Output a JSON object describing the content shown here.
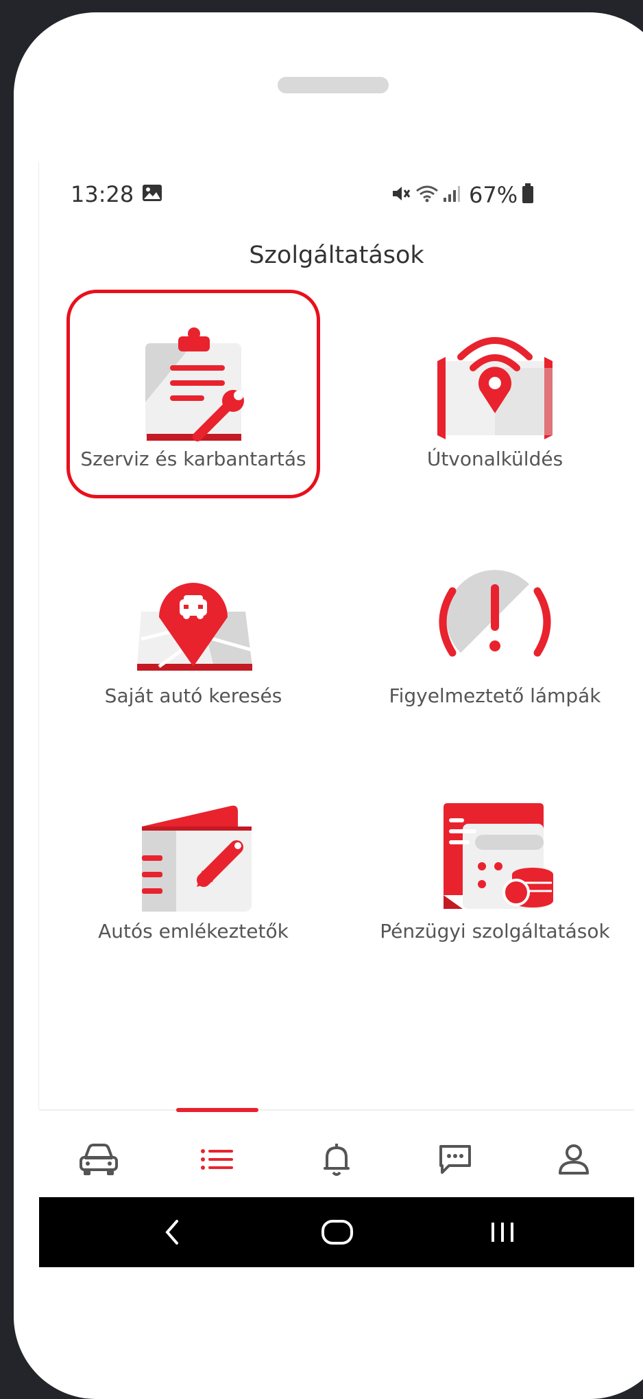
{
  "status_bar": {
    "time": "13:28",
    "image_icon": "image-icon",
    "mute_icon": "mute-icon",
    "wifi_icon": "wifi-icon",
    "signal_icon": "signal-icon",
    "battery_percent": "67%",
    "battery_icon": "battery-icon"
  },
  "header": {
    "title": "Szolgáltatások"
  },
  "services": [
    {
      "label": "Szerviz és karbantartás",
      "icon": "clipboard-wrench-icon",
      "selected": true
    },
    {
      "label": "Útvonalküldés",
      "icon": "map-pin-signal-icon"
    },
    {
      "label": "Saját autó keresés",
      "icon": "car-location-pin-icon"
    },
    {
      "label": "Figyelmeztető lámpák",
      "icon": "warning-light-icon"
    },
    {
      "label": "Autós emlékeztetők",
      "icon": "notebook-pencil-icon"
    },
    {
      "label": "Pénzügyi szolgáltatások",
      "icon": "finance-calculator-coins-icon"
    }
  ],
  "tab_bar": {
    "active": "services",
    "tabs": [
      {
        "id": "car",
        "icon": "car-icon"
      },
      {
        "id": "services",
        "icon": "list-icon"
      },
      {
        "id": "notifications",
        "icon": "bell-icon"
      },
      {
        "id": "messages",
        "icon": "chat-icon"
      },
      {
        "id": "profile",
        "icon": "user-icon"
      }
    ]
  },
  "nav_bar": {
    "back_icon": "back-icon",
    "home_icon": "home-icon",
    "recents_icon": "recents-icon"
  },
  "colors": {
    "accent": "#e8232e",
    "dark_accent": "#c41a24",
    "icon_gray": "#d6d6d6",
    "text": "#555555"
  }
}
